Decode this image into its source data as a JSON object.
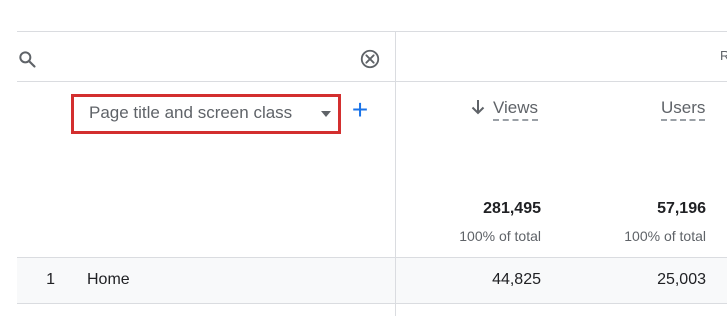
{
  "search": {
    "placeholder": ""
  },
  "edge_glyph": "R",
  "dimension": {
    "label": "Page title and screen class",
    "add_label": "+"
  },
  "metrics": [
    {
      "label": "Views",
      "sorted": true,
      "total": "281,495",
      "pct": "100% of total"
    },
    {
      "label": "Users",
      "sorted": false,
      "total": "57,196",
      "pct": "100% of total"
    }
  ],
  "rows": [
    {
      "index": "1",
      "title": "Home",
      "views": "44,825",
      "users": "25,003"
    }
  ],
  "colors": {
    "highlight": "#d32f2f",
    "accent": "#1a73e8",
    "row_bg": "#f8f9fa"
  }
}
